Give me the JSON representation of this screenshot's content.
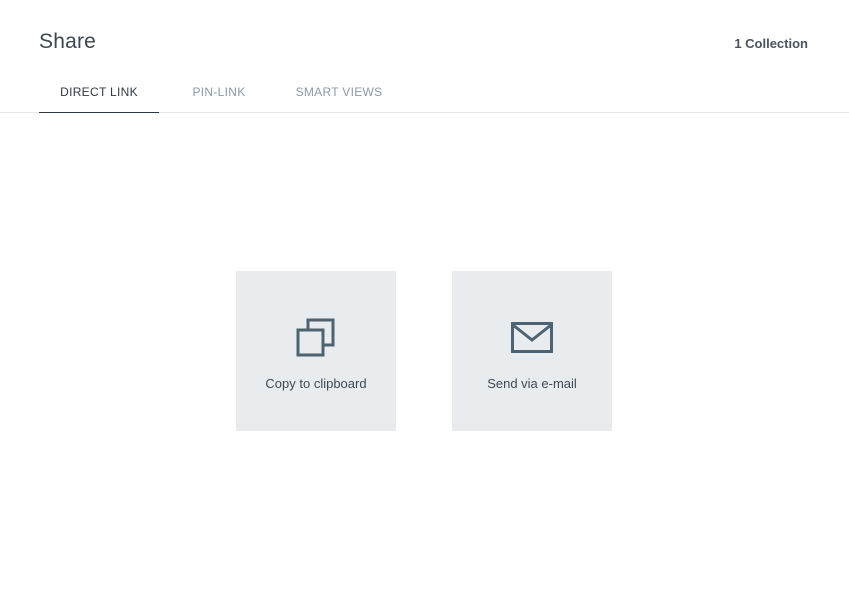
{
  "header": {
    "title": "Share",
    "collection_count": "1 Collection"
  },
  "tabs": [
    {
      "label": "DIRECT LINK",
      "active": true
    },
    {
      "label": "PIN-LINK",
      "active": false
    },
    {
      "label": "SMART VIEWS",
      "active": false
    }
  ],
  "actions": {
    "copy": {
      "label": "Copy to clipboard",
      "icon": "copy-icon"
    },
    "email": {
      "label": "Send via e-mail",
      "icon": "envelope-icon"
    }
  },
  "colors": {
    "tile_background": "#e9ecef",
    "icon_stroke": "#4e6372",
    "active_tab": "#2f3a44",
    "inactive_tab": "#8a9aa6"
  }
}
